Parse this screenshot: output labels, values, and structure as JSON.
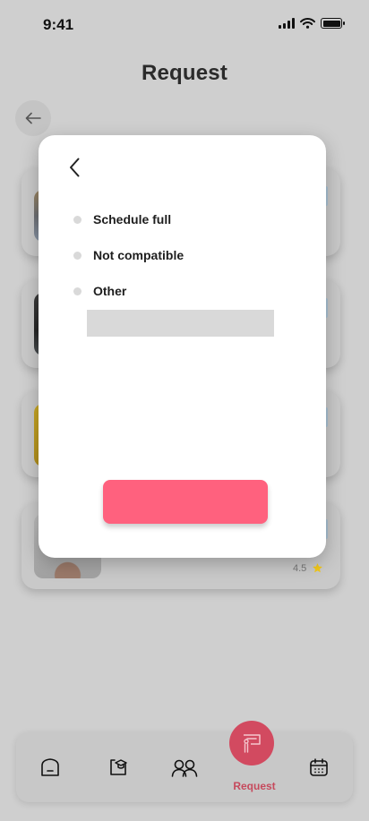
{
  "status_bar": {
    "time": "9:41"
  },
  "header": {
    "title": "Request"
  },
  "background_list": {
    "rating": "4.5"
  },
  "modal": {
    "options": [
      {
        "label": "Schedule full"
      },
      {
        "label": "Not compatible"
      },
      {
        "label": "Other"
      }
    ],
    "other_input": {
      "value": "",
      "placeholder": ""
    },
    "submit_label": ""
  },
  "bottom_nav": {
    "items": [
      {
        "icon": "home-icon",
        "label": ""
      },
      {
        "icon": "education-icon",
        "label": ""
      },
      {
        "icon": "users-icon",
        "label": ""
      },
      {
        "icon": "request-icon",
        "label": "Request",
        "active": true
      },
      {
        "icon": "calendar-icon",
        "label": ""
      }
    ]
  },
  "colors": {
    "accent": "#ff617e",
    "active_nav": "#d24a60",
    "star": "#f2c81a",
    "overlay_background": "#cfcfcf"
  }
}
